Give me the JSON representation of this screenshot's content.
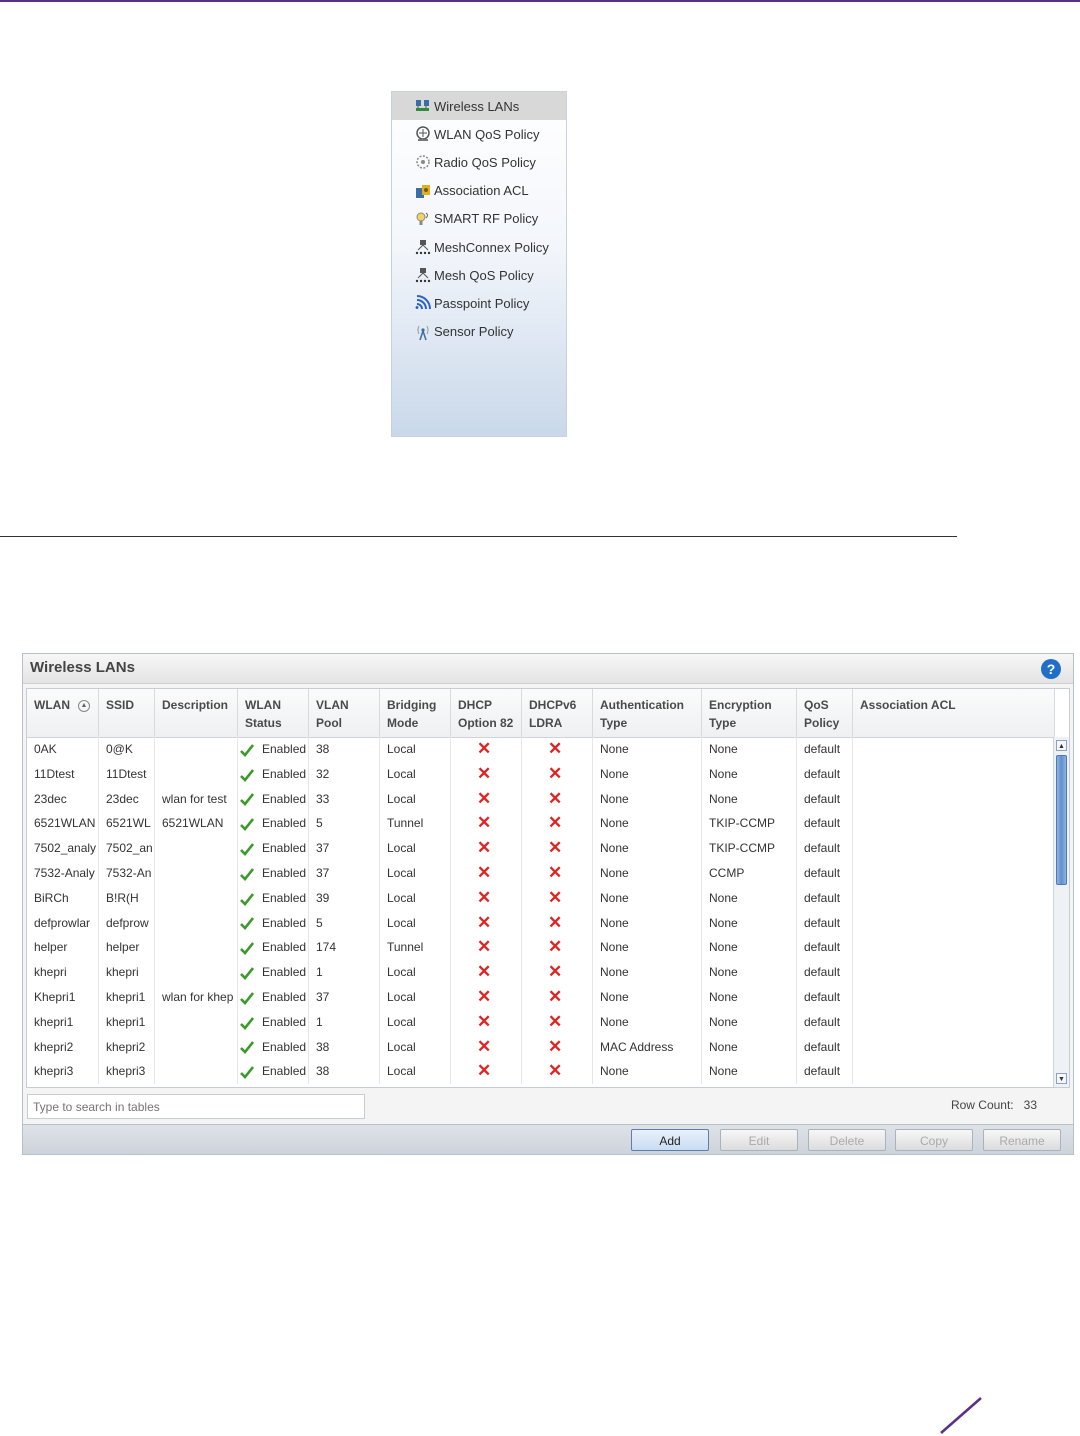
{
  "nav": {
    "items": [
      {
        "label": "Wireless LANs",
        "icon": "wireless-lans-icon",
        "active": true
      },
      {
        "label": "WLAN QoS Policy",
        "icon": "wlan-qos-icon",
        "active": false
      },
      {
        "label": "Radio QoS Policy",
        "icon": "radio-qos-icon",
        "active": false
      },
      {
        "label": "Association ACL",
        "icon": "association-acl-icon",
        "active": false
      },
      {
        "label": "SMART RF Policy",
        "icon": "smart-rf-icon",
        "active": false
      },
      {
        "label": "MeshConnex Policy",
        "icon": "meshconnex-icon",
        "active": false
      },
      {
        "label": "Mesh QoS Policy",
        "icon": "mesh-qos-icon",
        "active": false
      },
      {
        "label": "Passpoint Policy",
        "icon": "passpoint-icon",
        "active": false
      },
      {
        "label": "Sensor Policy",
        "icon": "sensor-icon",
        "active": false
      }
    ]
  },
  "window": {
    "title": "Wireless LANs",
    "help": "?",
    "columns": [
      {
        "line1": "WLAN",
        "line2": ""
      },
      {
        "line1": "SSID",
        "line2": ""
      },
      {
        "line1": "Description",
        "line2": ""
      },
      {
        "line1": "WLAN",
        "line2": "Status"
      },
      {
        "line1": "VLAN",
        "line2": "Pool"
      },
      {
        "line1": "Bridging",
        "line2": "Mode"
      },
      {
        "line1": "DHCP",
        "line2": "Option 82"
      },
      {
        "line1": "DHCPv6",
        "line2": "LDRA"
      },
      {
        "line1": "Authentication",
        "line2": "Type"
      },
      {
        "line1": "Encryption",
        "line2": "Type"
      },
      {
        "line1": "QoS",
        "line2": "Policy"
      },
      {
        "line1": "Association ACL",
        "line2": ""
      }
    ],
    "status_label": "Enabled",
    "x_mark": "✕",
    "rows": [
      {
        "wlan": "0AK",
        "ssid": "0@K",
        "desc": "",
        "pool": "38",
        "mode": "Local",
        "auth": "None",
        "enc": "None",
        "qos": "default",
        "acl": ""
      },
      {
        "wlan": "11Dtest",
        "ssid": "11Dtest",
        "desc": "",
        "pool": "32",
        "mode": "Local",
        "auth": "None",
        "enc": "None",
        "qos": "default",
        "acl": ""
      },
      {
        "wlan": "23dec",
        "ssid": "23dec",
        "desc": "wlan for test",
        "pool": "33",
        "mode": "Local",
        "auth": "None",
        "enc": "None",
        "qos": "default",
        "acl": ""
      },
      {
        "wlan": "6521WLAN",
        "ssid": "6521WL",
        "desc": "6521WLAN",
        "pool": "5",
        "mode": "Tunnel",
        "auth": "None",
        "enc": "TKIP-CCMP",
        "qos": "default",
        "acl": ""
      },
      {
        "wlan": "7502_analy",
        "ssid": "7502_an",
        "desc": "",
        "pool": "37",
        "mode": "Local",
        "auth": "None",
        "enc": "TKIP-CCMP",
        "qos": "default",
        "acl": ""
      },
      {
        "wlan": "7532-Analy",
        "ssid": "7532-An",
        "desc": "",
        "pool": "37",
        "mode": "Local",
        "auth": "None",
        "enc": "CCMP",
        "qos": "default",
        "acl": ""
      },
      {
        "wlan": "BiRCh",
        "ssid": "B!R(H",
        "desc": "",
        "pool": "39",
        "mode": "Local",
        "auth": "None",
        "enc": "None",
        "qos": "default",
        "acl": ""
      },
      {
        "wlan": "defprowlar",
        "ssid": "defprow",
        "desc": "",
        "pool": "5",
        "mode": "Local",
        "auth": "None",
        "enc": "None",
        "qos": "default",
        "acl": ""
      },
      {
        "wlan": "helper",
        "ssid": "helper",
        "desc": "",
        "pool": "174",
        "mode": "Tunnel",
        "auth": "None",
        "enc": "None",
        "qos": "default",
        "acl": ""
      },
      {
        "wlan": "khepri",
        "ssid": "khepri",
        "desc": "",
        "pool": "1",
        "mode": "Local",
        "auth": "None",
        "enc": "None",
        "qos": "default",
        "acl": ""
      },
      {
        "wlan": "Khepri1",
        "ssid": "khepri1",
        "desc": "wlan for khep",
        "pool": "37",
        "mode": "Local",
        "auth": "None",
        "enc": "None",
        "qos": "default",
        "acl": ""
      },
      {
        "wlan": "khepri1",
        "ssid": "khepri1",
        "desc": "",
        "pool": "1",
        "mode": "Local",
        "auth": "None",
        "enc": "None",
        "qos": "default",
        "acl": ""
      },
      {
        "wlan": "khepri2",
        "ssid": "khepri2",
        "desc": "",
        "pool": "38",
        "mode": "Local",
        "auth": "MAC Address",
        "enc": "None",
        "qos": "default",
        "acl": ""
      },
      {
        "wlan": "khepri3",
        "ssid": "khepri3",
        "desc": "",
        "pool": "38",
        "mode": "Local",
        "auth": "None",
        "enc": "None",
        "qos": "default",
        "acl": ""
      }
    ],
    "search_placeholder": "Type to search in tables",
    "row_count_label": "Row Count:",
    "row_count": "33",
    "buttons": {
      "add": "Add",
      "edit": "Edit",
      "delete": "Delete",
      "copy": "Copy",
      "rename": "Rename"
    }
  },
  "colors": {
    "accent": "#5a2f86",
    "enabled_green": "#3a9a2a",
    "x_red": "#e02424"
  }
}
